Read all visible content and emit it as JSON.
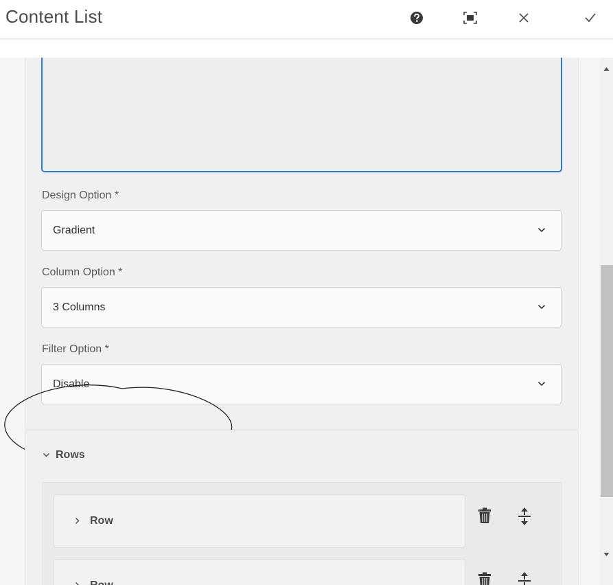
{
  "dialog": {
    "title": "Content List",
    "icons": {
      "help": "help-circle-icon",
      "fullscreen": "fullscreen-icon",
      "close": "close-icon",
      "done": "checkmark-icon"
    }
  },
  "form": {
    "design_option": {
      "label": "Design Option *",
      "value": "Gradient"
    },
    "column_option": {
      "label": "Column Option *",
      "value": "3 Columns"
    },
    "filter_option": {
      "label": "Filter Option *",
      "value": "Disable"
    }
  },
  "rows": {
    "label": "Rows",
    "items": [
      {
        "label": "Row"
      },
      {
        "label": "Row"
      }
    ]
  },
  "colors": {
    "focus_border": "#2b7cd3",
    "scroll_thumb": "#c1c1c1",
    "panel_bg": "#f0f0f0"
  }
}
